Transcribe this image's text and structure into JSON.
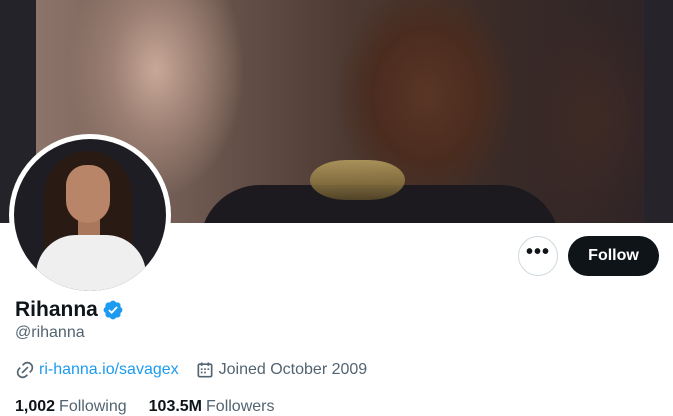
{
  "profile": {
    "display_name": "Rihanna",
    "handle": "@rihanna",
    "website": "ri-hanna.io/savagex",
    "joined": "Joined October 2009"
  },
  "actions": {
    "more_label": "•••",
    "follow_label": "Follow"
  },
  "stats": {
    "following_count": "1,002",
    "following_label": "Following",
    "followers_count": "103.5M",
    "followers_label": "Followers"
  },
  "icons": {
    "verified": "verified-badge-icon",
    "link": "link-icon",
    "calendar": "calendar-icon",
    "more": "more-options-icon"
  },
  "colors": {
    "accent": "#1d9bf0",
    "text_primary": "#0f1419",
    "text_secondary": "#536471",
    "follow_bg": "#0f1419"
  }
}
